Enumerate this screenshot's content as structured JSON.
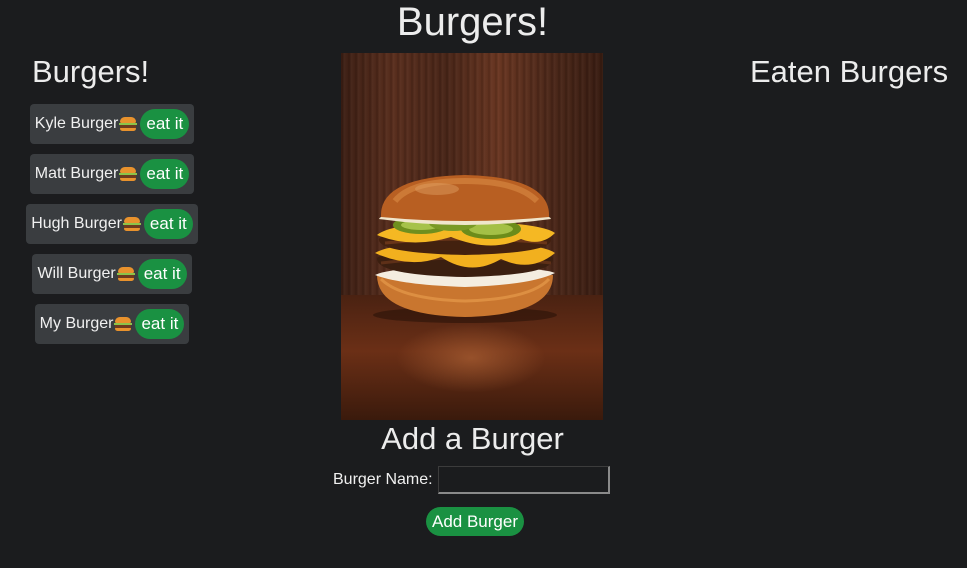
{
  "page": {
    "title": "Burgers!"
  },
  "uneaten": {
    "heading": "Burgers!",
    "items": [
      {
        "name": "Kyle Burger",
        "emoji_icon": "burger-icon",
        "action_label": "eat it"
      },
      {
        "name": "Matt Burger",
        "emoji_icon": "burger-icon",
        "action_label": "eat it"
      },
      {
        "name": "Hugh Burger",
        "emoji_icon": "burger-icon",
        "action_label": "eat it"
      },
      {
        "name": "Will Burger",
        "emoji_icon": "burger-icon",
        "action_label": "eat it"
      },
      {
        "name": "My Burger",
        "emoji_icon": "burger-icon",
        "action_label": "eat it"
      }
    ]
  },
  "eaten": {
    "heading": "Eaten Burgers",
    "items": []
  },
  "hero": {
    "image_subject": "burger-photo"
  },
  "form": {
    "heading": "Add a Burger",
    "name_label": "Burger Name:",
    "name_value": "",
    "name_placeholder": "",
    "submit_label": "Add Burger"
  },
  "colors": {
    "background": "#1b1c1e",
    "button_green": "#1a9142",
    "chip_gray": "#3a3d40",
    "text": "#ececec"
  }
}
